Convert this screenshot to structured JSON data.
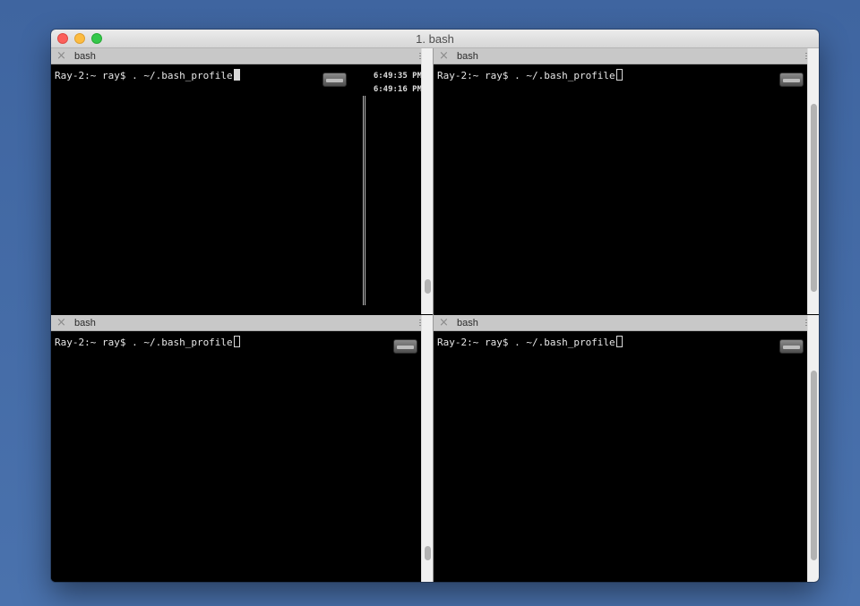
{
  "window": {
    "title": "1. bash"
  },
  "panes": [
    {
      "tab_label": "bash",
      "close_glyph": "×",
      "prompt": "Ray-2:~ ray$ . ~/.bash_profile",
      "cursor_style": "solid",
      "timestamps": [
        "6:49:35 PM",
        "6:49:16 PM"
      ]
    },
    {
      "tab_label": "bash",
      "close_glyph": "×",
      "prompt": "Ray-2:~ ray$ . ~/.bash_profile",
      "cursor_style": "hollow"
    },
    {
      "tab_label": "bash",
      "close_glyph": "×",
      "prompt": "Ray-2:~ ray$ . ~/.bash_profile",
      "cursor_style": "hollow"
    },
    {
      "tab_label": "bash",
      "close_glyph": "×",
      "prompt": "Ray-2:~ ray$ . ~/.bash_profile",
      "cursor_style": "hollow"
    }
  ],
  "colors": {
    "desktop": "#4a6fa5",
    "terminal_bg": "#000000",
    "terminal_fg": "#e6e6e6",
    "pane_header": "#c8c8c8",
    "close_button": "#fc605b",
    "minimize_button": "#fdbc40",
    "zoom_button": "#34c84a"
  },
  "icons": {
    "tab_menu": "hamburger-icon",
    "drive": "hard-drive-icon"
  }
}
